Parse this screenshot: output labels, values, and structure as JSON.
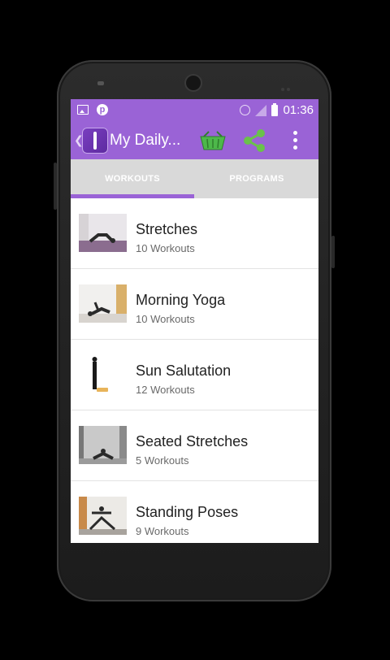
{
  "status_bar": {
    "time": "01:36",
    "left_icons": [
      "gallery-icon",
      "pinterest-icon"
    ],
    "right_icons": [
      "alarm-icon",
      "signal-icon",
      "battery-charging-icon"
    ]
  },
  "action_bar": {
    "title": "My Daily...",
    "icons": [
      "app-logo-icon",
      "basket-icon",
      "share-icon",
      "overflow-menu-icon"
    ]
  },
  "tabs": [
    {
      "label": "WORKOUTS",
      "selected": true
    },
    {
      "label": "PROGRAMS",
      "selected": false
    }
  ],
  "colors": {
    "accent": "#9a63d6",
    "tab_bar": "#d9d9d9",
    "basket_green": "#4db84a"
  },
  "workouts": [
    {
      "title": "Stretches",
      "subtitle": "10 Workouts"
    },
    {
      "title": "Morning Yoga",
      "subtitle": "10 Workouts"
    },
    {
      "title": "Sun Salutation",
      "subtitle": "12 Workouts"
    },
    {
      "title": "Seated Stretches",
      "subtitle": "5 Workouts"
    },
    {
      "title": "Standing Poses",
      "subtitle": "9 Workouts"
    }
  ]
}
